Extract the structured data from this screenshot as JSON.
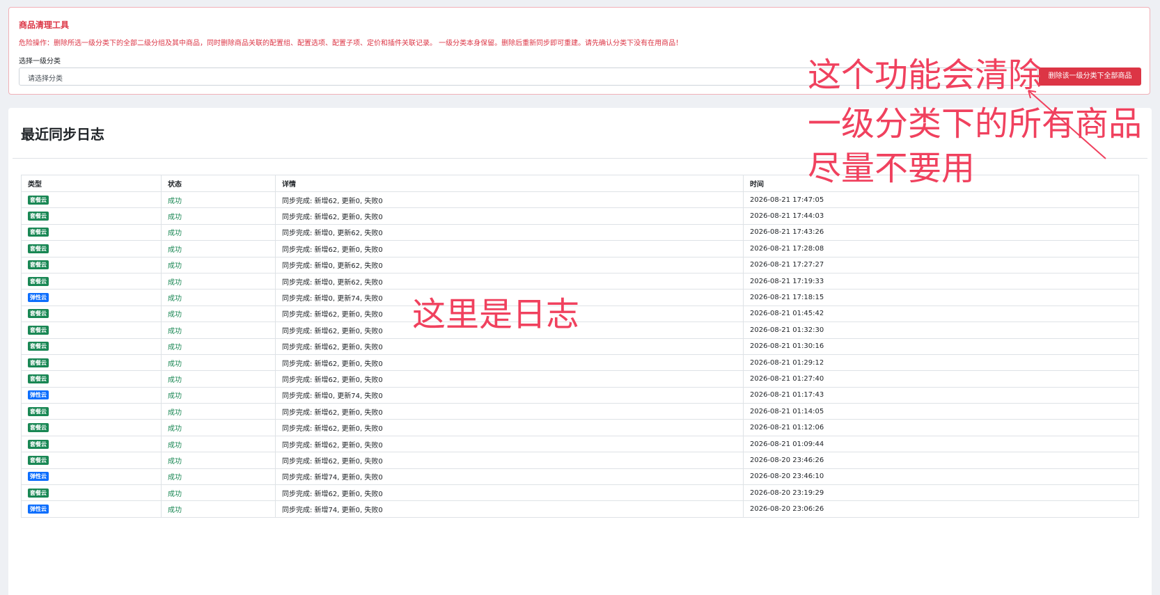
{
  "tool": {
    "title": "商品清理工具",
    "warning": "危险操作：删除所选一级分类下的全部二级分组及其中商品，同时删除商品关联的配置组、配置选项、配置子项、定价和插件关联记录。 一级分类本身保留。删除后重新同步即可重建。请先确认分类下没有在用商品！",
    "select_label": "选择一级分类",
    "select_placeholder": "请选择分类",
    "delete_button": "删除该一级分类下全部商品"
  },
  "log": {
    "title": "最近同步日志",
    "columns": [
      "类型",
      "状态",
      "详情",
      "时间"
    ],
    "rows": [
      {
        "type": "套餐云",
        "status": "成功",
        "detail": "同步完成: 新增62, 更新0, 失败0",
        "time": "2026-08-21 17:47:05"
      },
      {
        "type": "套餐云",
        "status": "成功",
        "detail": "同步完成: 新增62, 更新0, 失败0",
        "time": "2026-08-21 17:44:03"
      },
      {
        "type": "套餐云",
        "status": "成功",
        "detail": "同步完成: 新增0, 更新62, 失败0",
        "time": "2026-08-21 17:43:26"
      },
      {
        "type": "套餐云",
        "status": "成功",
        "detail": "同步完成: 新增62, 更新0, 失败0",
        "time": "2026-08-21 17:28:08"
      },
      {
        "type": "套餐云",
        "status": "成功",
        "detail": "同步完成: 新增0, 更新62, 失败0",
        "time": "2026-08-21 17:27:27"
      },
      {
        "type": "套餐云",
        "status": "成功",
        "detail": "同步完成: 新增0, 更新62, 失败0",
        "time": "2026-08-21 17:19:33"
      },
      {
        "type": "弹性云",
        "status": "成功",
        "detail": "同步完成: 新增0, 更新74, 失败0",
        "time": "2026-08-21 17:18:15"
      },
      {
        "type": "套餐云",
        "status": "成功",
        "detail": "同步完成: 新增62, 更新0, 失败0",
        "time": "2026-08-21 01:45:42"
      },
      {
        "type": "套餐云",
        "status": "成功",
        "detail": "同步完成: 新增62, 更新0, 失败0",
        "time": "2026-08-21 01:32:30"
      },
      {
        "type": "套餐云",
        "status": "成功",
        "detail": "同步完成: 新增62, 更新0, 失败0",
        "time": "2026-08-21 01:30:16"
      },
      {
        "type": "套餐云",
        "status": "成功",
        "detail": "同步完成: 新增62, 更新0, 失败0",
        "time": "2026-08-21 01:29:12"
      },
      {
        "type": "套餐云",
        "status": "成功",
        "detail": "同步完成: 新增62, 更新0, 失败0",
        "time": "2026-08-21 01:27:40"
      },
      {
        "type": "弹性云",
        "status": "成功",
        "detail": "同步完成: 新增0, 更新74, 失败0",
        "time": "2026-08-21 01:17:43"
      },
      {
        "type": "套餐云",
        "status": "成功",
        "detail": "同步完成: 新增62, 更新0, 失败0",
        "time": "2026-08-21 01:14:05"
      },
      {
        "type": "套餐云",
        "status": "成功",
        "detail": "同步完成: 新增62, 更新0, 失败0",
        "time": "2026-08-21 01:12:06"
      },
      {
        "type": "套餐云",
        "status": "成功",
        "detail": "同步完成: 新增62, 更新0, 失败0",
        "time": "2026-08-21 01:09:44"
      },
      {
        "type": "套餐云",
        "status": "成功",
        "detail": "同步完成: 新增62, 更新0, 失败0",
        "time": "2026-08-20 23:46:26"
      },
      {
        "type": "弹性云",
        "status": "成功",
        "detail": "同步完成: 新增74, 更新0, 失败0",
        "time": "2026-08-20 23:46:10"
      },
      {
        "type": "套餐云",
        "status": "成功",
        "detail": "同步完成: 新增62, 更新0, 失败0",
        "time": "2026-08-20 23:19:29"
      },
      {
        "type": "弹性云",
        "status": "成功",
        "detail": "同步完成: 新增74, 更新0, 失败0",
        "time": "2026-08-20 23:06:26"
      }
    ]
  },
  "annotations": {
    "top_lines": [
      "这个功能会清除",
      "一级分类下的所有商品",
      "尽量不要用"
    ],
    "log_note": "这里是日志"
  },
  "colors": {
    "danger": "#dc3545",
    "success": "#198754",
    "badge_package": "#198754",
    "badge_elastic": "#0d6efd",
    "annotation": "#f0415e"
  }
}
